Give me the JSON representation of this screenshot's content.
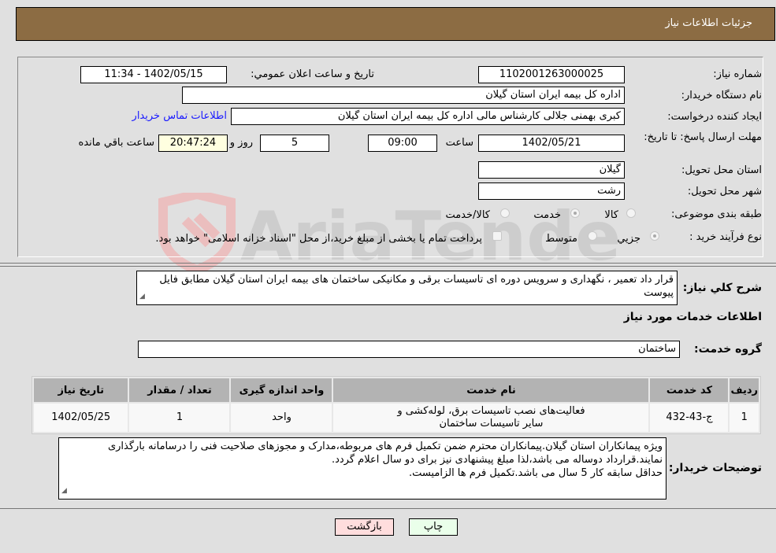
{
  "header": {
    "title": "جزئیات اطلاعات نیاز"
  },
  "form": {
    "need_number": {
      "label": "شماره نیاز:",
      "value": "1102001263000025"
    },
    "announce_datetime": {
      "label": "تاریخ و ساعت اعلان عمومي:",
      "value": "1402/05/15 - 11:34"
    },
    "buyer_org": {
      "label": "نام دستگاه خریدار:",
      "value": "اداره کل بیمه ایران استان گیلان"
    },
    "requester": {
      "label": "ایجاد کننده درخواست:",
      "value": "کبری بهمنی جلالی کارشناس مالی  اداره کل بیمه ایران استان گیلان"
    },
    "buyer_contact_link": "اطلاعات تماس خریدار",
    "deadline": {
      "label": "مهلت ارسال پاسخ: تا تاریخ:",
      "date": "1402/05/21",
      "time_label": "ساعت",
      "time": "09:00",
      "days": "5",
      "days_label": "روز و",
      "remaining": "20:47:24",
      "remaining_label": "ساعت باقي مانده"
    },
    "delivery_province": {
      "label": "استان محل تحویل:",
      "value": "گیلان"
    },
    "delivery_city": {
      "label": "شهر محل تحویل:",
      "value": "رشت"
    },
    "category": {
      "label": "طبقه بندی موضوعی:",
      "options": [
        "کالا",
        "خدمت",
        "کالا/خدمت"
      ],
      "selected": "خدمت"
    },
    "purchase_type": {
      "label": "نوع فرآیند خرید :",
      "options": [
        "جزيي",
        "متوسط"
      ],
      "selected": "جزيي",
      "treasury_note": "پرداخت تمام یا بخشی از مبلغ خرید،از محل \"اسناد خزانه اسلامی\" خواهد بود."
    }
  },
  "description": {
    "label": "شرح کلي نياز:",
    "text": "قرار داد تعمیر ، نگهداری و سرویس دوره ای تاسیسات برقی و مکانیکی ساختمان های بیمه ایران استان گیلان مطابق فایل پیوست"
  },
  "services": {
    "section_title": "اطلاعات خدمات مورد نياز",
    "group_label": "گروه خدمت:",
    "group_value": "ساختمان",
    "columns": [
      "ردیف",
      "کد خدمت",
      "نام خدمت",
      "واحد اندازه گیری",
      "تعداد / مقدار",
      "تاریخ نیاز"
    ],
    "rows": [
      {
        "row": "1",
        "code": "ج-43-432",
        "name": "فعالیت‌های نصب تاسیسات برق، لوله‌کشی و سایر تاسیسات ساختمان",
        "unit": "واحد",
        "qty": "1",
        "date": "1402/05/25"
      }
    ]
  },
  "buyer_notes": {
    "label": "توضیحات خریدار:",
    "lines": [
      "ویژه پیمانکاران استان گیلان.پیمانکاران محترم ضمن تکمیل فرم های مربوطه،مدارک و مجوزهای صلاحیت فنی را درسامانه بارگذاری نمایند.قرارداد دوساله می باشد،لذا مبلغ پیشنهادی نیز برای دو سال اعلام گردد.",
      "حداقل سابقه کار 5 سال می باشد.تکمیل فرم ها الزامیست."
    ]
  },
  "buttons": {
    "print": "چاپ",
    "back": "بازگشت"
  },
  "watermark": {
    "text": "AriaTender.neT"
  }
}
